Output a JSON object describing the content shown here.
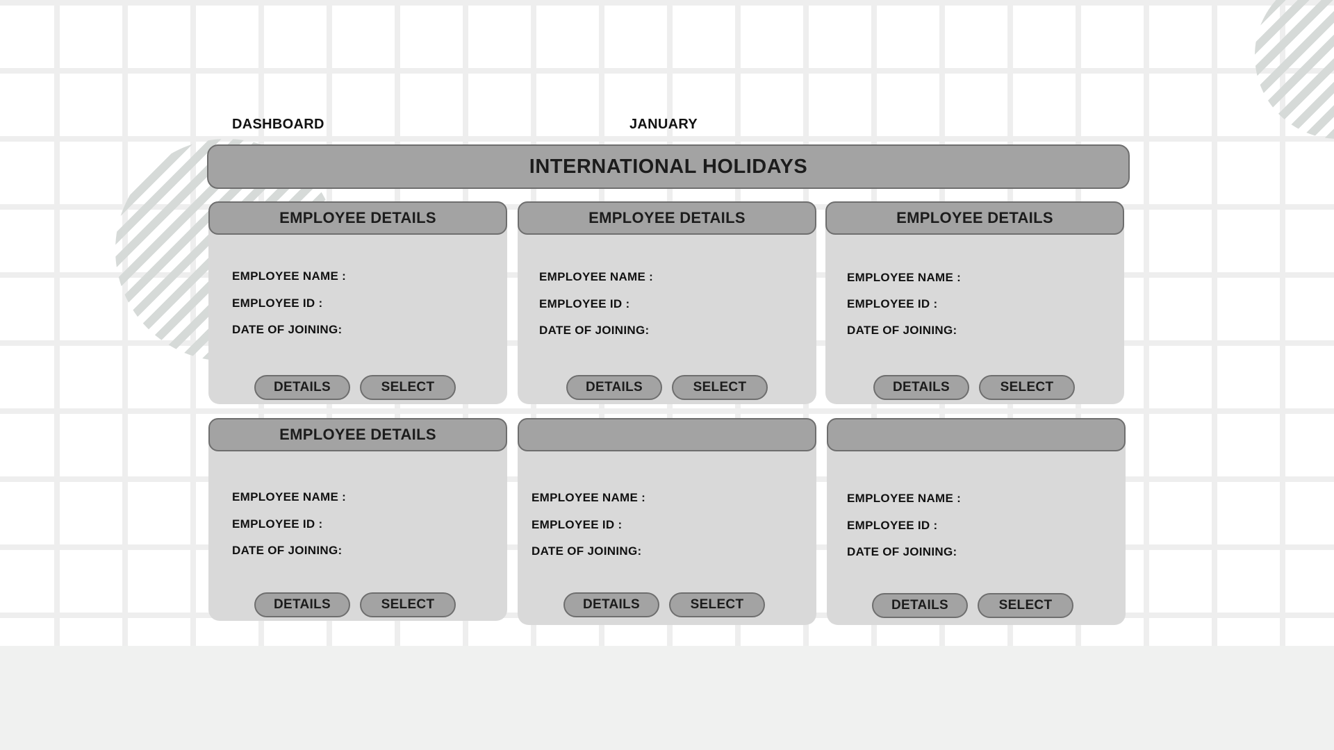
{
  "header": {
    "dashboard_label": "DASHBOARD",
    "month_label": "JANUARY",
    "banner_title": "INTERNATIONAL HOLIDAYS"
  },
  "cards": [
    {
      "title": "EMPLOYEE DETAILS",
      "name_label": "EMPLOYEE NAME :",
      "id_label": "EMPLOYEE ID :",
      "doj_label": "DATE OF JOINING:",
      "details_button": "DETAILS",
      "select_button": "SELECT"
    },
    {
      "title": "EMPLOYEE DETAILS",
      "name_label": "EMPLOYEE NAME :",
      "id_label": "EMPLOYEE ID :",
      "doj_label": "DATE OF JOINING:",
      "details_button": "DETAILS",
      "select_button": "SELECT"
    },
    {
      "title": "EMPLOYEE DETAILS",
      "name_label": "EMPLOYEE NAME :",
      "id_label": "EMPLOYEE ID :",
      "doj_label": "DATE OF JOINING:",
      "details_button": "DETAILS",
      "select_button": "SELECT"
    },
    {
      "title": "EMPLOYEE DETAILS",
      "name_label": "EMPLOYEE NAME :",
      "id_label": "EMPLOYEE ID :",
      "doj_label": "DATE OF JOINING:",
      "details_button": "DETAILS",
      "select_button": "SELECT"
    },
    {
      "title": "",
      "name_label": "EMPLOYEE NAME :",
      "id_label": "EMPLOYEE ID :",
      "doj_label": "DATE OF JOINING:",
      "details_button": "DETAILS",
      "select_button": "SELECT"
    },
    {
      "title": "",
      "name_label": "EMPLOYEE NAME :",
      "id_label": "EMPLOYEE ID :",
      "doj_label": "DATE OF JOINING:",
      "details_button": "DETAILS",
      "select_button": "SELECT"
    }
  ],
  "colors": {
    "panel": "#d9d9d9",
    "header": "#a3a3a3",
    "border": "#6e6e6e",
    "grid": "#eeeeee"
  }
}
